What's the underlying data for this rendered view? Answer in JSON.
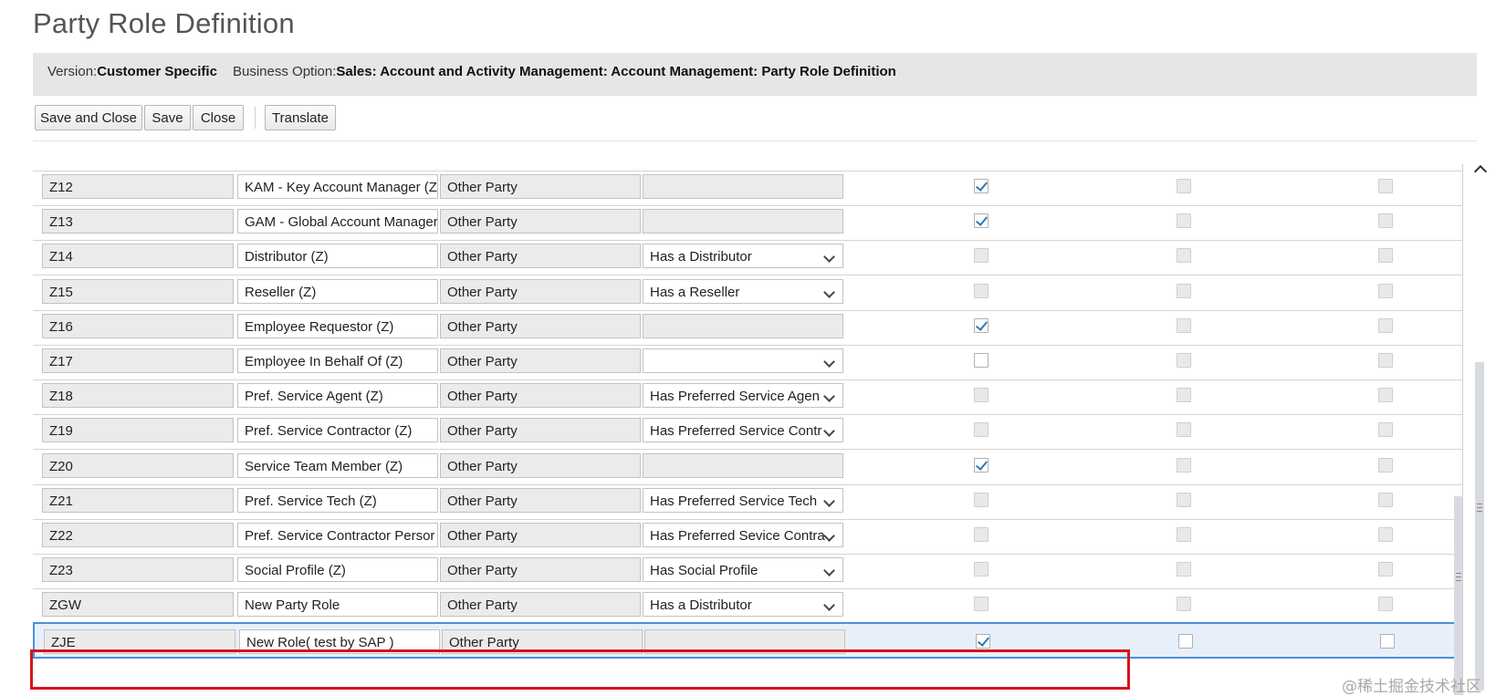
{
  "page": {
    "title": "Party Role Definition"
  },
  "info": {
    "version_label": "Version:",
    "version_value": "Customer Specific",
    "option_label": "Business Option:",
    "option_value": "Sales: Account and Activity Management: Account Management: Party Role Definition"
  },
  "toolbar": {
    "save_close": "Save and Close",
    "save": "Save",
    "close": "Close",
    "translate": "Translate"
  },
  "rows": [
    {
      "code": "Z12",
      "desc": "KAM - Key Account Manager (Z",
      "category": "Other Party",
      "relationship": "",
      "rel_dropdown": false,
      "cb1": true
    },
    {
      "code": "Z13",
      "desc": "GAM - Global Account Manager",
      "category": "Other Party",
      "relationship": "",
      "rel_dropdown": false,
      "cb1": true
    },
    {
      "code": "Z14",
      "desc": "Distributor (Z)",
      "category": "Other Party",
      "relationship": "Has a Distributor",
      "rel_dropdown": true,
      "cb1": false
    },
    {
      "code": "Z15",
      "desc": "Reseller (Z)",
      "category": "Other Party",
      "relationship": "Has a Reseller",
      "rel_dropdown": true,
      "cb1": false
    },
    {
      "code": "Z16",
      "desc": "Employee Requestor (Z)",
      "category": "Other Party",
      "relationship": "",
      "rel_dropdown": false,
      "cb1": true
    },
    {
      "code": "Z17",
      "desc": "Employee In Behalf Of (Z)",
      "category": "Other Party",
      "relationship": "",
      "rel_dropdown": true,
      "cb1": false,
      "cb1_enabled": true
    },
    {
      "code": "Z18",
      "desc": "Pref. Service Agent (Z)",
      "category": "Other Party",
      "relationship": "Has Preferred Service Agen",
      "rel_dropdown": true,
      "cb1": false
    },
    {
      "code": "Z19",
      "desc": "Pref. Service Contractor (Z)",
      "category": "Other Party",
      "relationship": "Has Preferred Service Contr",
      "rel_dropdown": true,
      "cb1": false
    },
    {
      "code": "Z20",
      "desc": "Service Team Member (Z)",
      "category": "Other Party",
      "relationship": "",
      "rel_dropdown": false,
      "cb1": true
    },
    {
      "code": "Z21",
      "desc": "Pref. Service Tech (Z)",
      "category": "Other Party",
      "relationship": "Has Preferred Service Tech",
      "rel_dropdown": true,
      "cb1": false
    },
    {
      "code": "Z22",
      "desc": "Pref. Service Contractor Persor",
      "category": "Other Party",
      "relationship": "Has Preferred Sevice Contra",
      "rel_dropdown": true,
      "cb1": false
    },
    {
      "code": "Z23",
      "desc": "Social Profile (Z)",
      "category": "Other Party",
      "relationship": "Has Social Profile",
      "rel_dropdown": true,
      "cb1": false
    },
    {
      "code": "ZGW",
      "desc": "New Party Role",
      "category": "Other Party",
      "relationship": "Has a Distributor",
      "rel_dropdown": true,
      "cb1": false
    },
    {
      "code": "ZJE",
      "desc": "New Role( test by SAP )",
      "category": "Other Party",
      "relationship": "",
      "rel_dropdown": false,
      "cb1": true,
      "selected": true
    }
  ],
  "watermark": "@稀土掘金技术社区",
  "colors": {
    "highlight": "#d9121b",
    "selection": "#4a90d9",
    "check": "#2a7ab8"
  }
}
